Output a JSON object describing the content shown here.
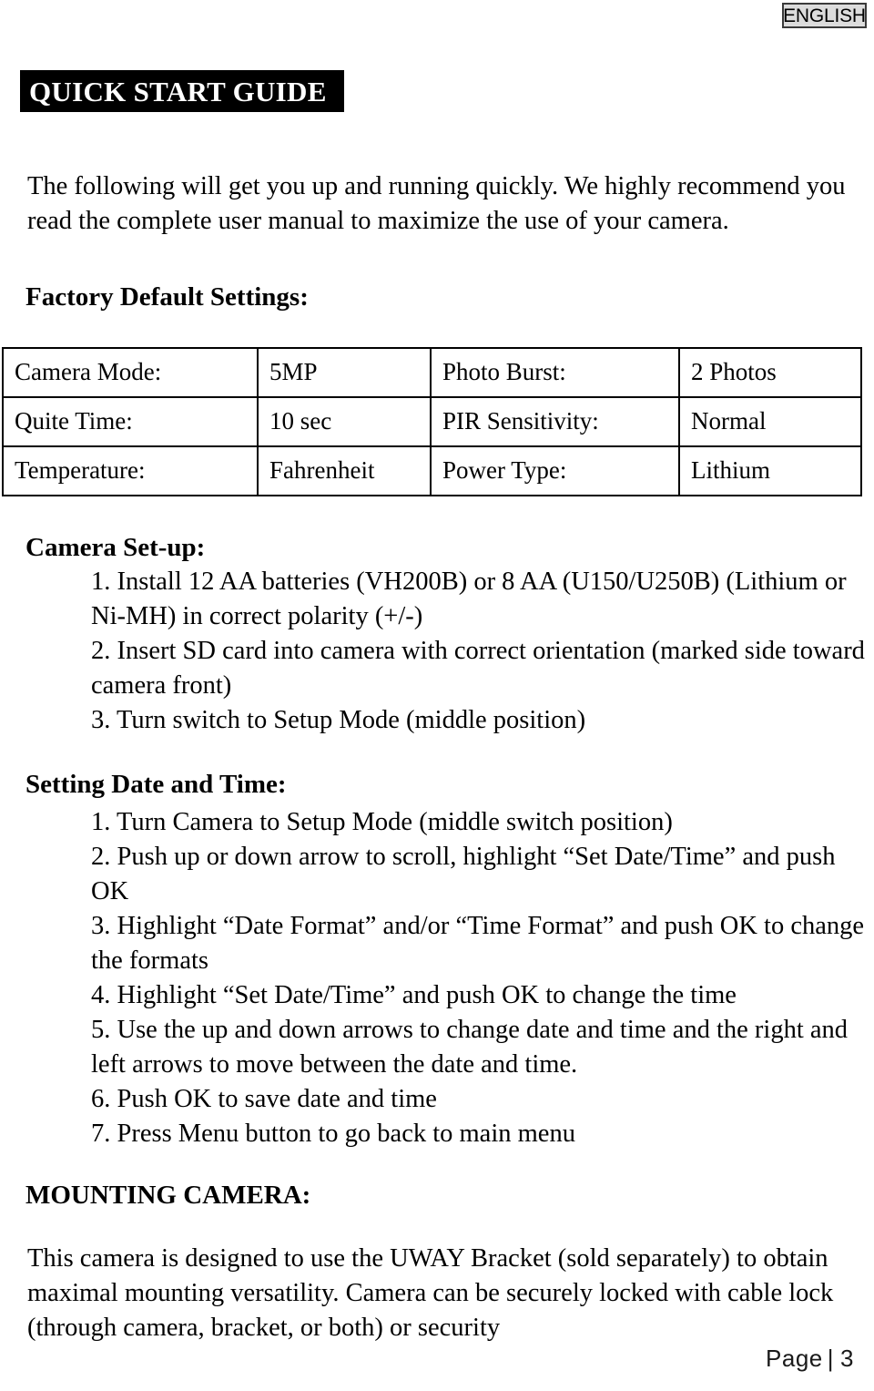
{
  "language_badge": "ENGLISH",
  "title": "QUICK START GUIDE",
  "intro": "The following will get you up and running quickly. We highly recommend you read the complete user manual to maximize the use of your camera.",
  "sections": {
    "factory_defaults": {
      "heading": "Factory Default Settings:",
      "rows": [
        {
          "label_a": "Camera Mode:",
          "value_a": "5MP",
          "label_b": "Photo Burst:",
          "value_b": "2 Photos"
        },
        {
          "label_a": "Quite Time:",
          "value_a": "10 sec",
          "label_b": "PIR Sensitivity:",
          "value_b": "Normal"
        },
        {
          "label_a": "Temperature:",
          "value_a": "Fahrenheit",
          "label_b": "Power Type:",
          "value_b": "Lithium"
        }
      ]
    },
    "camera_setup": {
      "heading": "Camera Set-up:",
      "steps": [
        "1. Install 12 AA batteries (VH200B) or 8 AA (U150/U250B) (Lithium or Ni-MH) in correct polarity (+/-)",
        "2. Insert SD card into camera with correct orientation (marked side  toward camera front)",
        "3. Turn switch to Setup Mode (middle position)"
      ]
    },
    "setting_date_time": {
      "heading": "Setting Date and Time:",
      "steps": [
        "1. Turn Camera to Setup Mode (middle switch position)",
        "2. Push up or down arrow to scroll, highlight “Set Date/Time” and push OK",
        "3. Highlight “Date Format” and/or “Time Format” and push OK to change the formats",
        "4. Highlight “Set Date/Time” and push OK to change the time",
        "5. Use the up and down arrows to change date and time and the right and left arrows to move between the date and time.",
        "6. Push OK to save date and time",
        "7. Press Menu button to go back to main menu"
      ]
    },
    "mounting_camera": {
      "heading": "MOUNTING CAMERA:",
      "body": "This camera is designed to use the UWAY Bracket (sold separately) to obtain maximal mounting versatility. Camera can be securely locked with cable lock (through camera, bracket, or both) or security"
    }
  },
  "footer": {
    "label": "Page",
    "separator": "|",
    "number": "3"
  }
}
